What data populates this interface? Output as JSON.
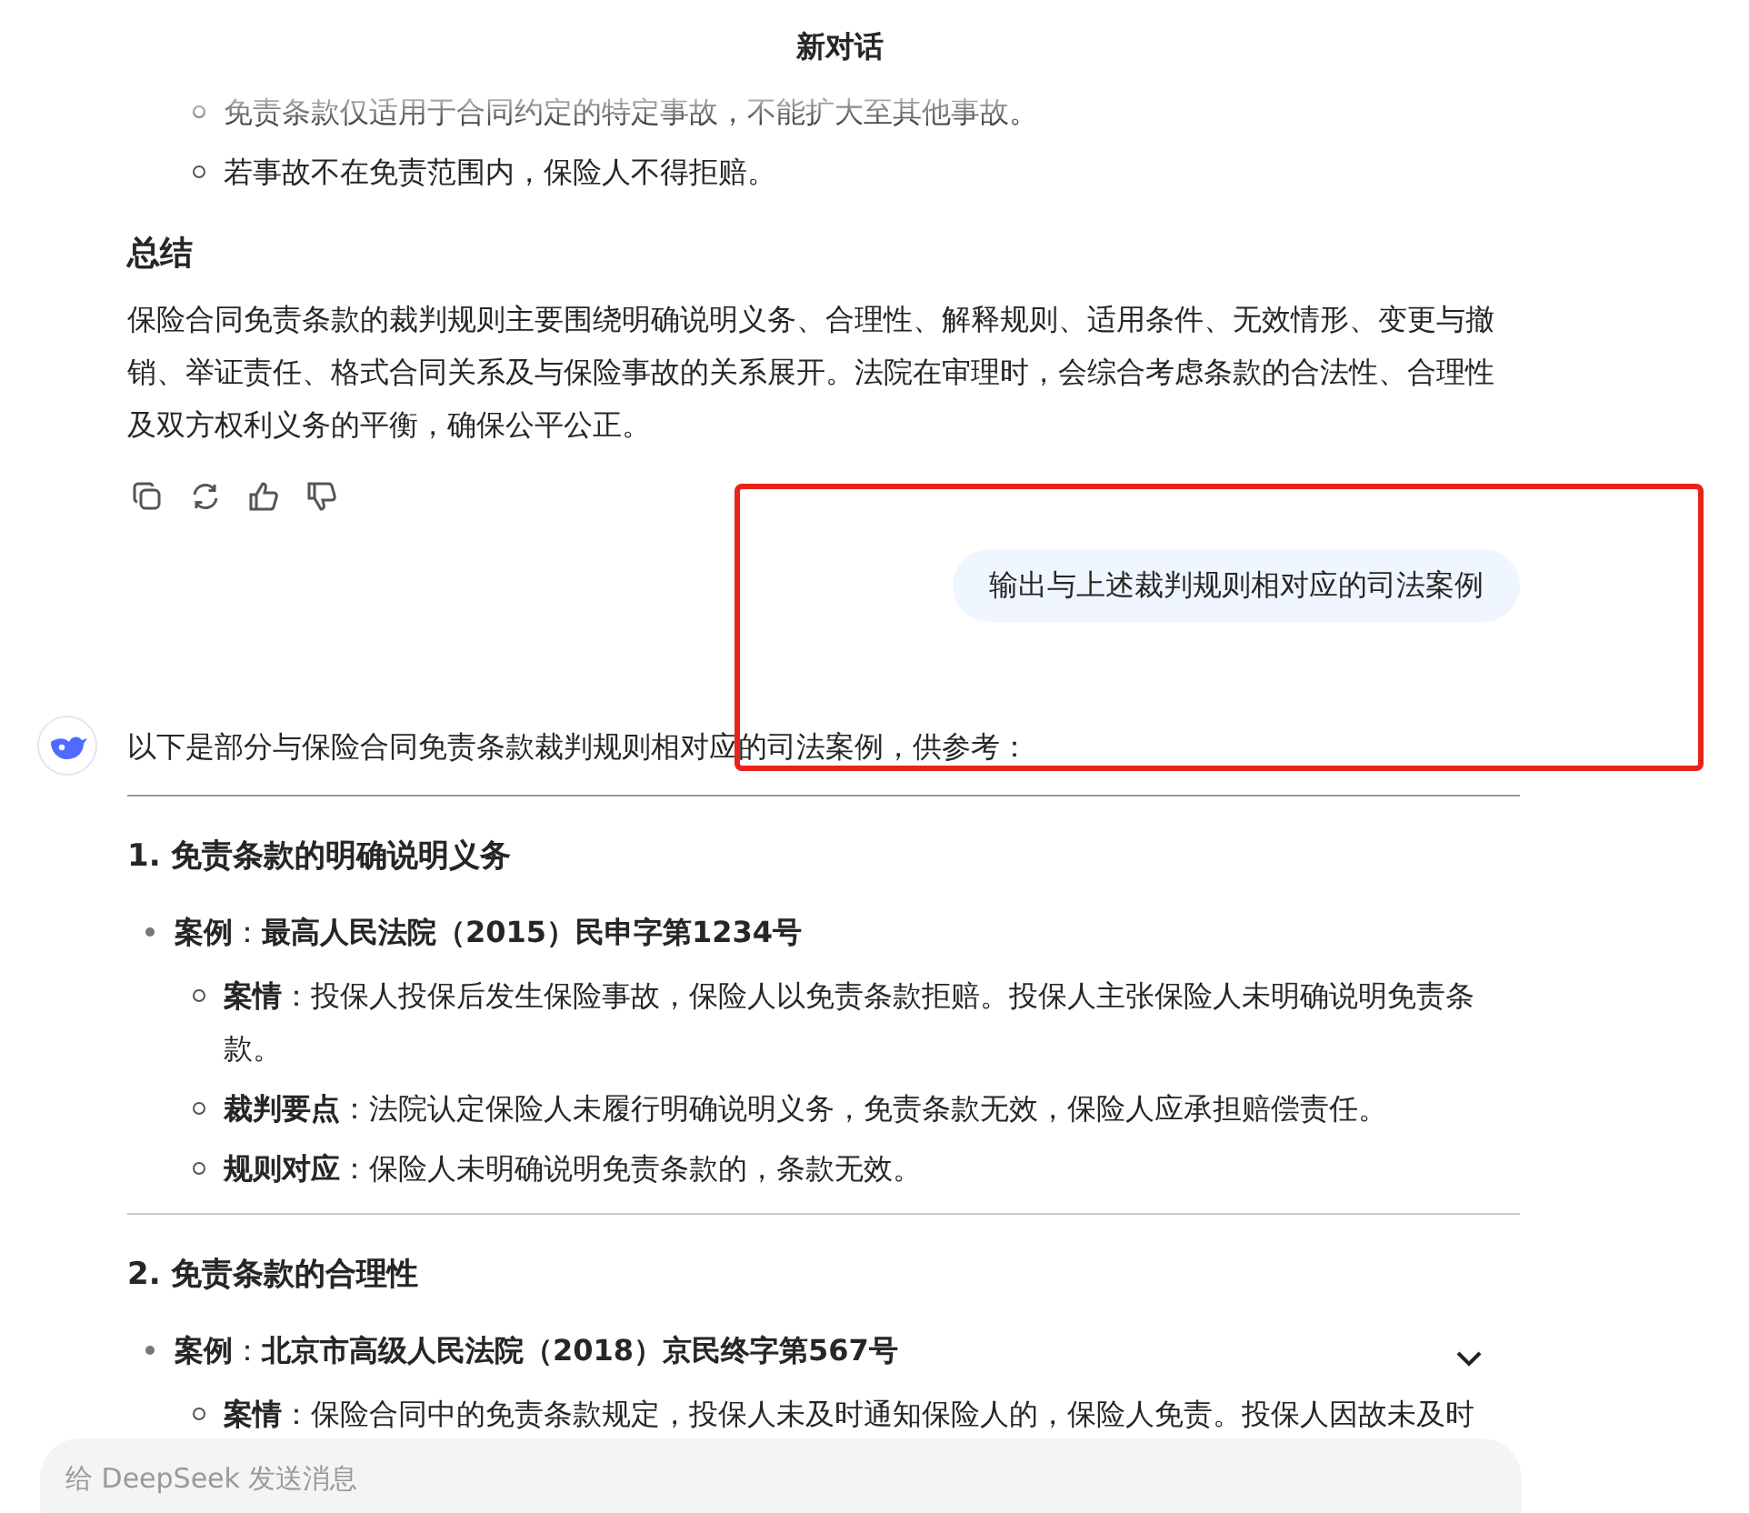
{
  "title": "新对话",
  "prev_subitems": [
    "免责条款仅适用于合同约定的特定事故，不能扩大至其他事故。",
    "若事故不在免责范围内，保险人不得拒赔。"
  ],
  "summary": {
    "heading": "总结",
    "text": "保险合同免责条款的裁判规则主要围绕明确说明义务、合理性、解释规则、适用条件、无效情形、变更与撤销、举证责任、格式合同关系及与保险事故的关系展开。法院在审理时，会综合考虑条款的合法性、合理性及双方权利义务的平衡，确保公平公正。"
  },
  "actions": [
    {
      "kind": "copy"
    },
    {
      "kind": "regenerate"
    },
    {
      "kind": "like"
    },
    {
      "kind": "dislike"
    }
  ],
  "user_message": "输出与上述裁判规则相对应的司法案例",
  "highlight_frame": true,
  "answer": {
    "intro": "以下是部分与保险合同免责条款裁判规则相对应的司法案例，供参考：",
    "sections": [
      {
        "heading": "1. 免责条款的明确说明义务",
        "case": "**案例**：**最高人民法院（2015）民申字第1234号**",
        "details": [
          "**案情**：投保人投保后发生保险事故，保险人以免责条款拒赔。投保人主张保险人未明确说明免责条款。",
          "**裁判要点**：法院认定保险人未履行明确说明义务，免责条款无效，保险人应承担赔偿责任。",
          "**规则对应**：保险人未明确说明免责条款的，条款无效。"
        ]
      },
      {
        "heading": "2. 免责条款的合理性",
        "case": "**案例**：**北京市高级人民法院（2018）京民终字第567号**",
        "details": [
          "**案情**：保险合同中的免责条款规定，投保人未及时通知保险人的，保险人免责。投保人因故未及时"
        ]
      }
    ]
  },
  "input": {
    "placeholder": "给 DeepSeek 发送消息"
  }
}
